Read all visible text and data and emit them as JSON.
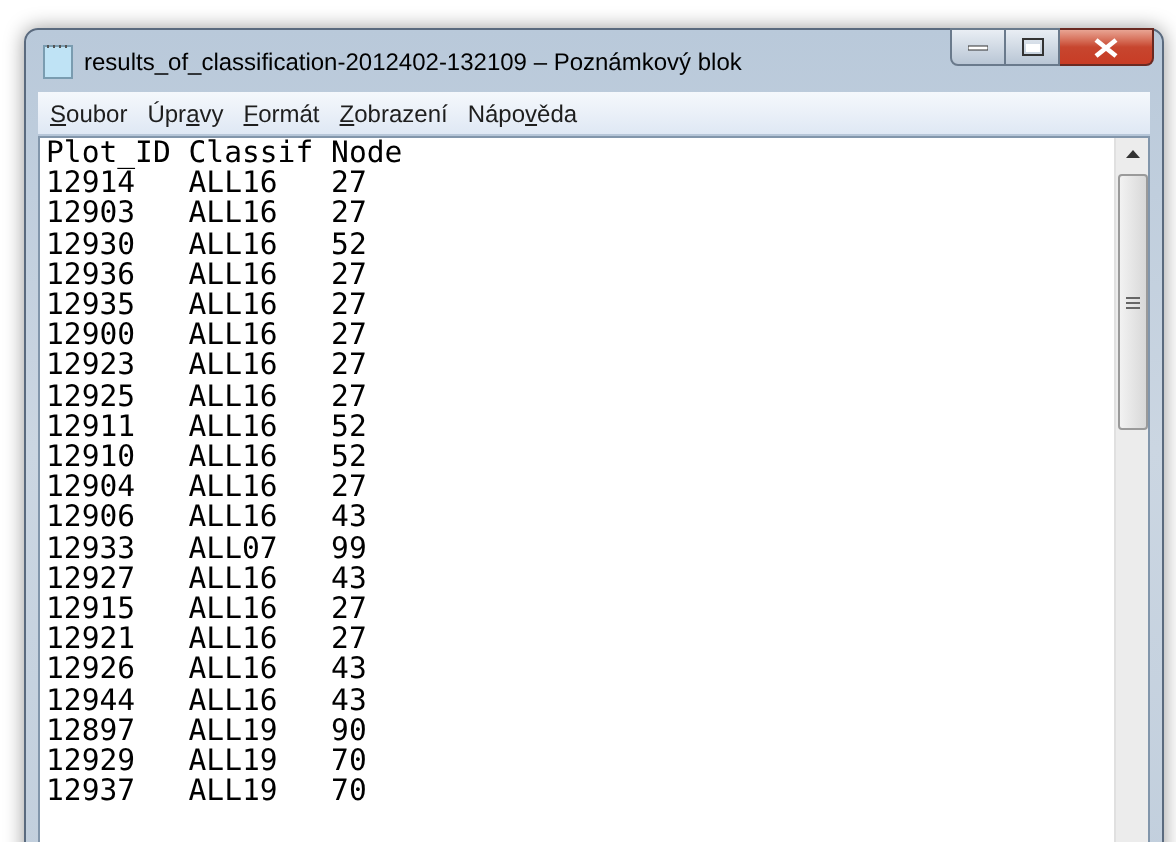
{
  "window": {
    "title": "results_of_classification-2012402-132109 – Poznámkový blok"
  },
  "menu": [
    {
      "access_key": "S",
      "rest": "oubor"
    },
    {
      "before": "Úpr",
      "access_key": "a",
      "rest": "vy"
    },
    {
      "access_key": "F",
      "rest": "ormát"
    },
    {
      "access_key": "Z",
      "rest": "obrazení"
    },
    {
      "before": "Nápo",
      "access_key": "v",
      "rest": "ěda"
    }
  ],
  "lines": [
    "Plot_ID Classif Node",
    "12914   ALL16   27",
    "12903   ALL16   27",
    "12930   ALL16   52",
    "12936   ALL16   27",
    "12935   ALL16   27",
    "12900   ALL16   27",
    "12923   ALL16   27",
    "12925   ALL16   27",
    "12911   ALL16   52",
    "12910   ALL16   52",
    "12904   ALL16   27",
    "12906   ALL16   43",
    "12933   ALL07   99",
    "12927   ALL16   43",
    "12915   ALL16   27",
    "12921   ALL16   27",
    "12926   ALL16   43",
    "12944   ALL16   43",
    "12897   ALL19   90",
    "12929   ALL19   70",
    "12937   ALL19   70"
  ]
}
